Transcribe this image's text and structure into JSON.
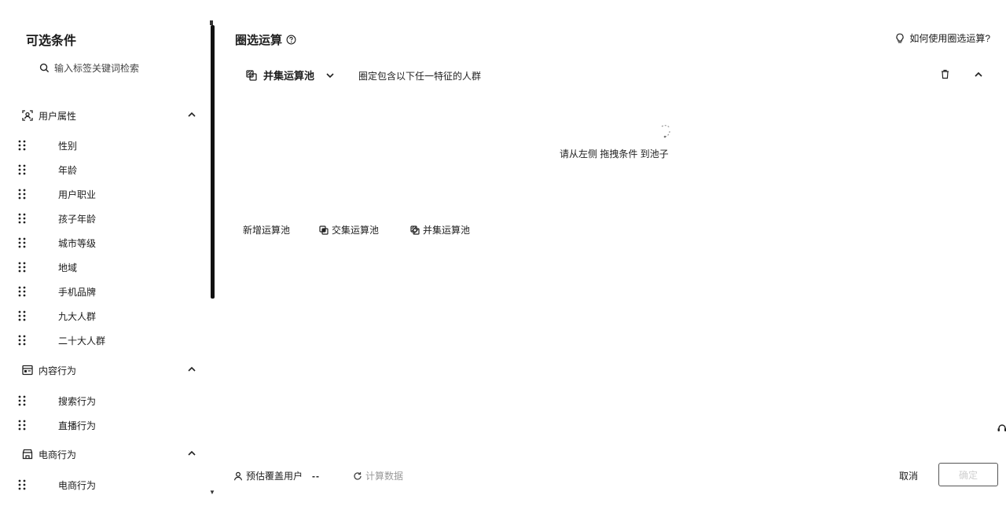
{
  "sidebar": {
    "title": "可选条件",
    "search_placeholder": "输入标签关键词检索",
    "groups": [
      {
        "label": "用户属性",
        "icon": "user-scan-icon",
        "items": [
          "性别",
          "年龄",
          "用户职业",
          "孩子年龄",
          "城市等级",
          "地域",
          "手机品牌",
          "九大人群",
          "二十大人群"
        ]
      },
      {
        "label": "内容行为",
        "icon": "content-icon",
        "items": [
          "搜索行为",
          "直播行为"
        ]
      },
      {
        "label": "电商行为",
        "icon": "shop-icon",
        "items": [
          "电商行为"
        ]
      }
    ]
  },
  "main": {
    "title": "圈选运算",
    "help_link": "如何使用圈选运算?",
    "pool": {
      "type_label": "并集运算池",
      "description": "圈定包含以下任一特征的人群",
      "empty_hint": "请从左侧 拖拽条件 到池子"
    },
    "actions": {
      "add_pool": "新增运算池",
      "intersect_pool": "交集运算池",
      "union_pool": "并集运算池"
    }
  },
  "footer": {
    "estimate_label": "预估覆盖用户",
    "estimate_value": "--",
    "refresh_label": "计算数据",
    "cancel_label": "取消",
    "confirm_label": "确定"
  }
}
